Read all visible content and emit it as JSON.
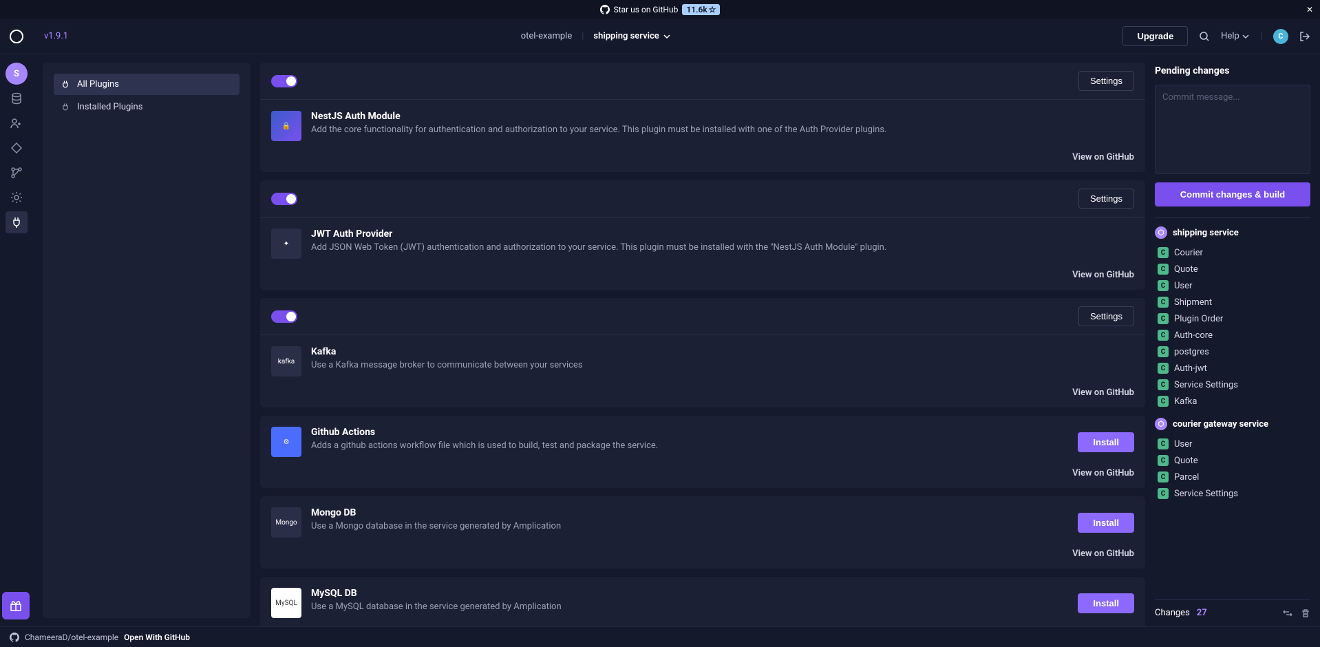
{
  "banner": {
    "text": "Star us on GitHub",
    "star_count": "11.6k"
  },
  "header": {
    "version": "v1.9.1",
    "project": "otel-example",
    "service": "shipping service",
    "upgrade_label": "Upgrade",
    "help_label": "Help",
    "avatar_initial": "C"
  },
  "iconbar": {
    "badge_initial": "S"
  },
  "sidebar": {
    "items": [
      {
        "label": "All Plugins"
      },
      {
        "label": "Installed Plugins"
      }
    ]
  },
  "plugins": [
    {
      "installed": true,
      "settings_label": "Settings",
      "title": "NestJS Auth Module",
      "desc": "Add the core functionality for authentication and authorization to your service. This plugin must be installed with one of the Auth Provider plugins.",
      "view_label": "View on GitHub",
      "icon_class": "grad",
      "icon_text": "🔒"
    },
    {
      "installed": true,
      "settings_label": "Settings",
      "title": "JWT Auth Provider",
      "desc": "Add JSON Web Token (JWT) authentication and authorization to your service. This plugin must be installed with the \"NestJS Auth Module\" plugin.",
      "view_label": "View on GitHub",
      "icon_class": "",
      "icon_text": "✦"
    },
    {
      "installed": true,
      "settings_label": "Settings",
      "title": "Kafka",
      "desc": "Use a Kafka message broker to communicate between your services",
      "view_label": "View on GitHub",
      "icon_class": "",
      "icon_text": "kafka"
    },
    {
      "installed": false,
      "install_label": "Install",
      "title": "Github Actions",
      "desc": "Adds a github actions workflow file which is used to build, test and package the service.",
      "view_label": "View on GitHub",
      "icon_class": "blue",
      "icon_text": "⚙"
    },
    {
      "installed": false,
      "install_label": "Install",
      "title": "Mongo DB",
      "desc": "Use a Mongo database in the service generated by Amplication",
      "view_label": "View on GitHub",
      "icon_class": "",
      "icon_text": "Mongo"
    },
    {
      "installed": false,
      "install_label": "Install",
      "title": "MySQL DB",
      "desc": "Use a MySQL database in the service generated by Amplication",
      "view_label": "View on GitHub",
      "icon_class": "white",
      "icon_text": "MySQL"
    }
  ],
  "rightpanel": {
    "title": "Pending changes",
    "commit_placeholder": "Commit message...",
    "commit_btn": "Commit changes & build",
    "services": [
      {
        "name": "shipping service",
        "changes": [
          {
            "badge": "C",
            "label": "Courier"
          },
          {
            "badge": "C",
            "label": "Quote"
          },
          {
            "badge": "C",
            "label": "User"
          },
          {
            "badge": "C",
            "label": "Shipment"
          },
          {
            "badge": "C",
            "label": "Plugin Order"
          },
          {
            "badge": "C",
            "label": "Auth-core"
          },
          {
            "badge": "C",
            "label": "postgres"
          },
          {
            "badge": "C",
            "label": "Auth-jwt"
          },
          {
            "badge": "C",
            "label": "Service Settings"
          },
          {
            "badge": "C",
            "label": "Kafka"
          }
        ]
      },
      {
        "name": "courier gateway service",
        "changes": [
          {
            "badge": "C",
            "label": "User"
          },
          {
            "badge": "C",
            "label": "Quote"
          },
          {
            "badge": "C",
            "label": "Parcel"
          },
          {
            "badge": "C",
            "label": "Service Settings"
          }
        ]
      }
    ],
    "changes_label": "Changes",
    "changes_count": "27"
  },
  "footer": {
    "repo": "ChameeraD/otel-example",
    "open_label": "Open With GitHub"
  }
}
